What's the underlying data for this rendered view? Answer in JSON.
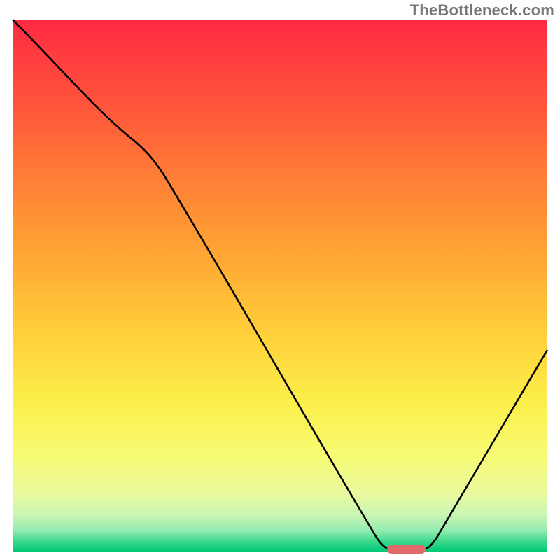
{
  "watermark": "TheBottleneck.com",
  "colors": {
    "gradient_top": "#ff2a42",
    "gradient_bottom": "#00c878",
    "curve": "#000000",
    "marker": "#e06a6a",
    "watermark": "#777777",
    "background": "#ffffff"
  },
  "chart_data": {
    "type": "line",
    "title": "",
    "xlabel": "",
    "ylabel": "",
    "xlim": [
      0,
      100
    ],
    "ylim": [
      0,
      100
    ],
    "x": [
      0,
      22,
      70,
      77,
      100
    ],
    "values": [
      100,
      78,
      0,
      0,
      38
    ],
    "annotations": [
      {
        "name": "optimal-marker",
        "x_start": 70,
        "x_end": 77,
        "y": 0
      }
    ],
    "background_gradient_stops": [
      {
        "pos": 0.0,
        "color": "#ff2a42"
      },
      {
        "pos": 0.18,
        "color": "#ff5a3a"
      },
      {
        "pos": 0.3,
        "color": "#ff7f36"
      },
      {
        "pos": 0.45,
        "color": "#ffa834"
      },
      {
        "pos": 0.6,
        "color": "#ffd23a"
      },
      {
        "pos": 0.72,
        "color": "#fcef4a"
      },
      {
        "pos": 0.82,
        "color": "#f7fb74"
      },
      {
        "pos": 0.89,
        "color": "#e9fa9d"
      },
      {
        "pos": 0.93,
        "color": "#cbf6b3"
      },
      {
        "pos": 0.96,
        "color": "#93edb0"
      },
      {
        "pos": 0.98,
        "color": "#40d98e"
      },
      {
        "pos": 1.0,
        "color": "#00c878"
      }
    ]
  }
}
